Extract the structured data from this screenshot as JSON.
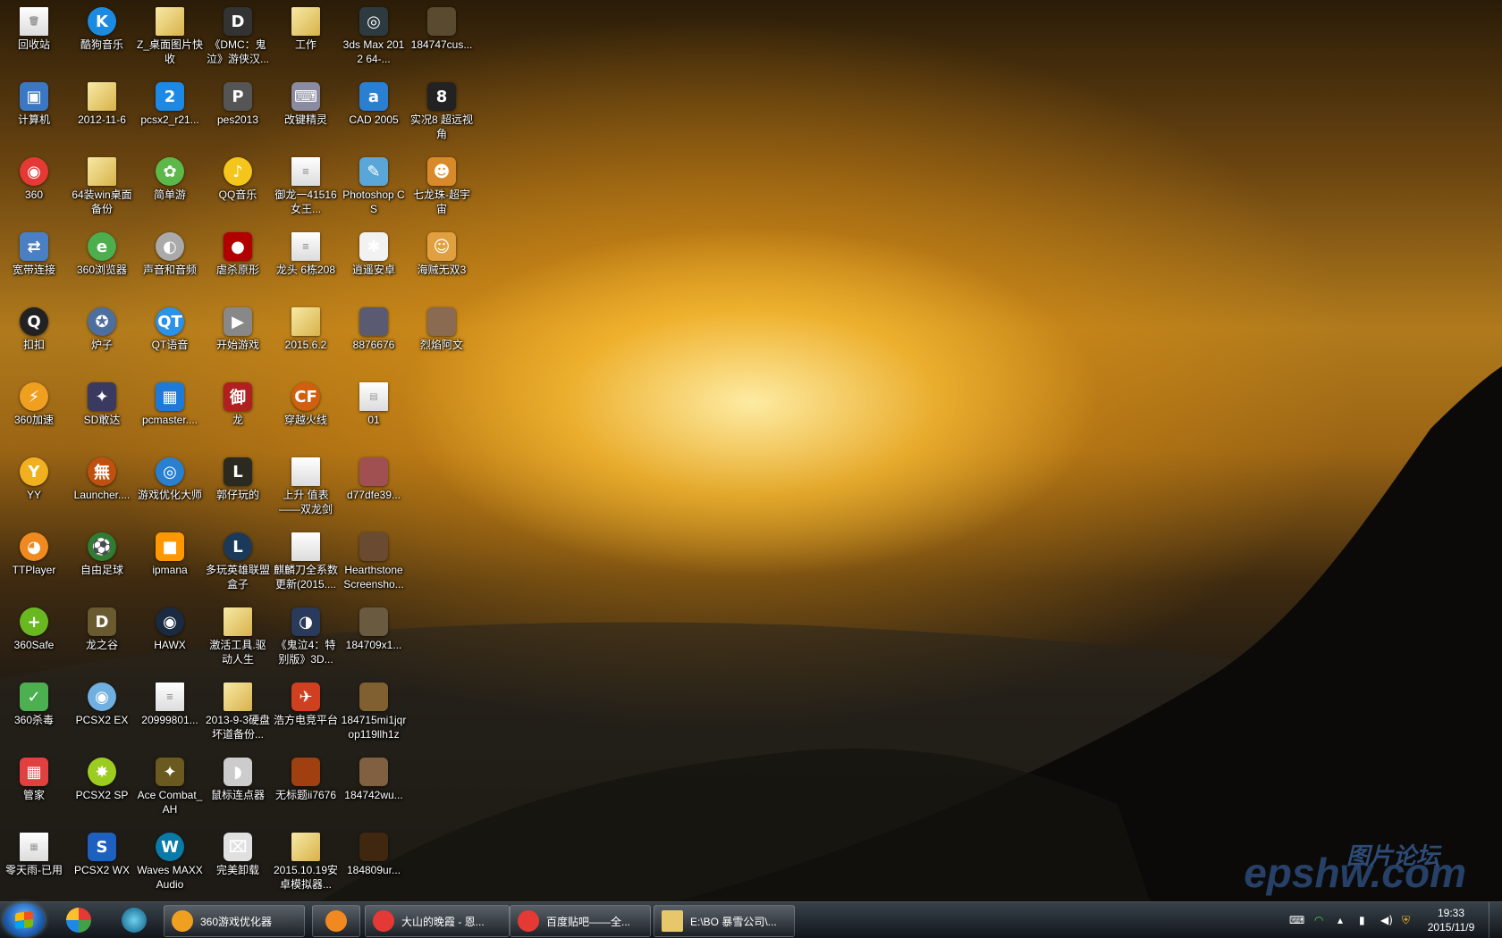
{
  "desktop": {
    "icons": [
      {
        "label": "回收站",
        "glyph": "🗑",
        "bg": "#9fb6c8",
        "shape": "doc"
      },
      {
        "label": "酷狗音乐",
        "glyph": "K",
        "bg": "#1a8be0",
        "shape": "round"
      },
      {
        "label": "Z_桌面图片快收",
        "glyph": "",
        "bg": "#e6c86a",
        "shape": "folder"
      },
      {
        "label": "《DMC：鬼泣》游侠汉...",
        "glyph": "D",
        "bg": "#333",
        "shape": "sq"
      },
      {
        "label": "工作",
        "glyph": "",
        "bg": "#e6c86a",
        "shape": "folder"
      },
      {
        "label": "3ds Max 2012 64-...",
        "glyph": "◎",
        "bg": "#2d3a40",
        "shape": "sq"
      },
      {
        "label": "184747cus...",
        "glyph": "",
        "bg": "#5a4a30",
        "shape": "sq"
      },
      {
        "label": "计算机",
        "glyph": "▣",
        "bg": "#3b78c4",
        "shape": "sq"
      },
      {
        "label": "2012-11-6",
        "glyph": "",
        "bg": "#e6c86a",
        "shape": "folder"
      },
      {
        "label": "pcsx2_r21...",
        "glyph": "2",
        "bg": "#1e88e5",
        "shape": "sq"
      },
      {
        "label": "pes2013",
        "glyph": "P",
        "bg": "#555",
        "shape": "sq"
      },
      {
        "label": "改键精灵",
        "glyph": "⌨",
        "bg": "#8a8aa0",
        "shape": "sq"
      },
      {
        "label": "CAD 2005",
        "glyph": "a",
        "bg": "#2a7fd0",
        "shape": "sq"
      },
      {
        "label": "实况8 超远视角",
        "glyph": "8",
        "bg": "#222",
        "shape": "sq"
      },
      {
        "label": "360",
        "glyph": "◉",
        "bg": "#e53935",
        "shape": "round"
      },
      {
        "label": "64装win桌面备份",
        "glyph": "",
        "bg": "#e6c86a",
        "shape": "folder"
      },
      {
        "label": "简单游",
        "glyph": "✿",
        "bg": "#5db84a",
        "shape": "round"
      },
      {
        "label": "QQ音乐",
        "glyph": "♪",
        "bg": "#f4c51b",
        "shape": "round"
      },
      {
        "label": "御龙一41516女王...",
        "glyph": "≡",
        "bg": "#fff",
        "shape": "doc"
      },
      {
        "label": "Photoshop CS",
        "glyph": "✎",
        "bg": "#5aa6d8",
        "shape": "sq"
      },
      {
        "label": "七龙珠-超宇宙",
        "glyph": "☻",
        "bg": "#d88a2a",
        "shape": "sq"
      },
      {
        "label": "宽带连接",
        "glyph": "⇄",
        "bg": "#4a7fc4",
        "shape": "sq"
      },
      {
        "label": "360浏览器",
        "glyph": "e",
        "bg": "#4cae4c",
        "shape": "round"
      },
      {
        "label": "声音和音频",
        "glyph": "◐",
        "bg": "#aaa",
        "shape": "round"
      },
      {
        "label": "虐杀原形",
        "glyph": "●",
        "bg": "#b00000",
        "shape": "sq"
      },
      {
        "label": "龙头 6栋208",
        "glyph": "≡",
        "bg": "#fff",
        "shape": "doc"
      },
      {
        "label": "逍遥安卓",
        "glyph": "✱",
        "bg": "#f2f2f2",
        "shape": "sq"
      },
      {
        "label": "海贼无双3",
        "glyph": "☺",
        "bg": "#e0a040",
        "shape": "sq"
      },
      {
        "label": "扣扣",
        "glyph": "Q",
        "bg": "#222",
        "shape": "round"
      },
      {
        "label": "炉子",
        "glyph": "✪",
        "bg": "#4d6fa0",
        "shape": "round"
      },
      {
        "label": "QT语音",
        "glyph": "QT",
        "bg": "#2a92e8",
        "shape": "round"
      },
      {
        "label": "开始游戏",
        "glyph": "▶",
        "bg": "#888",
        "shape": "sq"
      },
      {
        "label": "2015.6.2",
        "glyph": "",
        "bg": "#e6c86a",
        "shape": "folder"
      },
      {
        "label": "8876676",
        "glyph": "",
        "bg": "#5a5a70",
        "shape": "sq"
      },
      {
        "label": "烈焰阿文",
        "glyph": "",
        "bg": "#8a6a50",
        "shape": "sq"
      },
      {
        "label": "360加速",
        "glyph": "⚡",
        "bg": "#f0a020",
        "shape": "round"
      },
      {
        "label": "SD敢达",
        "glyph": "✦",
        "bg": "#3a3a60",
        "shape": "sq"
      },
      {
        "label": "pcmaster....",
        "glyph": "▦",
        "bg": "#1e7ad8",
        "shape": "sq"
      },
      {
        "label": "龙",
        "glyph": "御",
        "bg": "#b02020",
        "shape": "sq"
      },
      {
        "label": "穿越火线",
        "glyph": "CF",
        "bg": "#d06010",
        "shape": "round"
      },
      {
        "label": "01",
        "glyph": "▤",
        "bg": "#6aa0e0",
        "shape": "doc"
      },
      {
        "label": "YY",
        "glyph": "Y",
        "bg": "#f0b020",
        "shape": "round"
      },
      {
        "label": "Launcher....",
        "glyph": "無",
        "bg": "#c05010",
        "shape": "round"
      },
      {
        "label": "游戏优化大师",
        "glyph": "◎",
        "bg": "#2a80d0",
        "shape": "round"
      },
      {
        "label": "郭仔玩的",
        "glyph": "L",
        "bg": "#2a2a20",
        "shape": "sq"
      },
      {
        "label": "上升 值表——双龙剑",
        "glyph": "",
        "bg": "#ccc",
        "shape": "doc"
      },
      {
        "label": "d77dfe39...",
        "glyph": "",
        "bg": "#a05050",
        "shape": "sq"
      },
      {
        "label": "TTPlayer",
        "glyph": "◕",
        "bg": "#f08a20",
        "shape": "round"
      },
      {
        "label": "自由足球",
        "glyph": "⚽",
        "bg": "#2e7d32",
        "shape": "round"
      },
      {
        "label": "ipmana",
        "glyph": "■",
        "bg": "#ff9800",
        "shape": "sq"
      },
      {
        "label": "多玩英雄联盟盒子",
        "glyph": "L",
        "bg": "#1b3a5a",
        "shape": "round"
      },
      {
        "label": "麒麟刀全系数更新(2015....",
        "glyph": "",
        "bg": "#ddd",
        "shape": "doc"
      },
      {
        "label": "Hearthstone Screensho...",
        "glyph": "",
        "bg": "#6a4a30",
        "shape": "sq"
      },
      {
        "label": "360Safe",
        "glyph": "+",
        "bg": "#6ab820",
        "shape": "round"
      },
      {
        "label": "龙之谷",
        "glyph": "D",
        "bg": "#6a5a30",
        "shape": "sq"
      },
      {
        "label": "HAWX",
        "glyph": "◉",
        "bg": "#1a2a40",
        "shape": "round"
      },
      {
        "label": "激活工具.驱动人生",
        "glyph": "",
        "bg": "#e6c86a",
        "shape": "folder"
      },
      {
        "label": "《鬼泣4：特别版》3D...",
        "glyph": "◑",
        "bg": "#2a3a5a",
        "shape": "sq"
      },
      {
        "label": "184709x1...",
        "glyph": "",
        "bg": "#6a5a40",
        "shape": "sq"
      },
      {
        "label": "360杀毒",
        "glyph": "✓",
        "bg": "#4caf50",
        "shape": "sq"
      },
      {
        "label": "PCSX2 EX",
        "glyph": "◉",
        "bg": "#70b0e0",
        "shape": "round"
      },
      {
        "label": "20999801...",
        "glyph": "≡",
        "bg": "#fff",
        "shape": "doc"
      },
      {
        "label": "2013-9-3硬盘坏道备份...",
        "glyph": "",
        "bg": "#e6c86a",
        "shape": "folder"
      },
      {
        "label": "浩方电竞平台",
        "glyph": "✈",
        "bg": "#d04020",
        "shape": "sq"
      },
      {
        "label": "184715mi1jqrop119llh1z",
        "glyph": "",
        "bg": "#806030",
        "shape": "sq"
      },
      {
        "label": "管家",
        "glyph": "▦",
        "bg": "#e04040",
        "shape": "sq"
      },
      {
        "label": "PCSX2 SP",
        "glyph": "✸",
        "bg": "#9ccc20",
        "shape": "round"
      },
      {
        "label": "Ace Combat_AH",
        "glyph": "✦",
        "bg": "#6a5a20",
        "shape": "sq"
      },
      {
        "label": "鼠标连点器",
        "glyph": "◗",
        "bg": "#ccc",
        "shape": "sq"
      },
      {
        "label": "无标题ii7676",
        "glyph": "",
        "bg": "#a04010",
        "shape": "sq"
      },
      {
        "label": "184742wu...",
        "glyph": "",
        "bg": "#806040",
        "shape": "sq"
      },
      {
        "label": "零天雨-已用",
        "glyph": "▦",
        "bg": "#ddd",
        "shape": "doc"
      },
      {
        "label": "PCSX2 WX",
        "glyph": "S",
        "bg": "#1e60c0",
        "shape": "sq"
      },
      {
        "label": "Waves MAXXAudio",
        "glyph": "W",
        "bg": "#0a7aa8",
        "shape": "round"
      },
      {
        "label": "完美卸载",
        "glyph": "⌧",
        "bg": "#e0e0e0",
        "shape": "sq"
      },
      {
        "label": "2015.10.19安卓模拟器...",
        "glyph": "",
        "bg": "#e6c86a",
        "shape": "folder"
      },
      {
        "label": "184809ur...",
        "glyph": "",
        "bg": "#402810",
        "shape": "sq"
      }
    ]
  },
  "taskbar": {
    "tasks": [
      {
        "label": "360游戏优化器",
        "bg": "#f0a020"
      },
      {
        "label": "",
        "bg": "#f08a20"
      },
      {
        "label": "大山的晚霞 - 恩...",
        "bg": "#e53935"
      },
      {
        "label": "百度贴吧——全...",
        "bg": "#e53935"
      },
      {
        "label": "E:\\BO 暴雪公司\\...",
        "bg": "#e6c86a"
      }
    ],
    "clock": {
      "time": "19:33",
      "date": "2015/11/9"
    }
  },
  "watermark": {
    "text": "epshw.com",
    "cn": "图片论坛"
  }
}
